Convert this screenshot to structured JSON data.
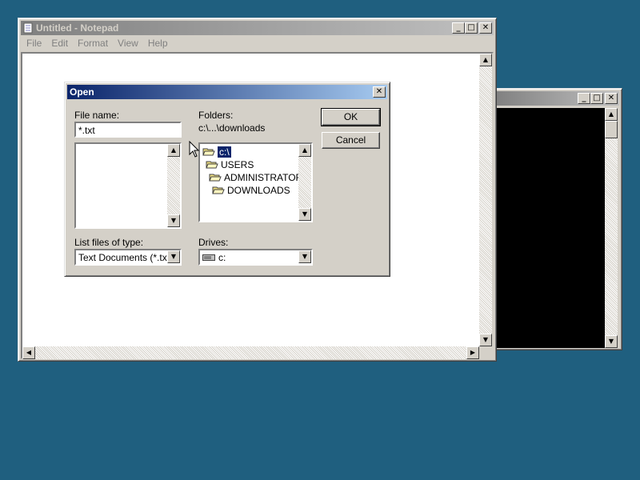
{
  "console_window": {
    "minimize_glyph": "_",
    "maximize_glyph": "□",
    "close_glyph": "✕",
    "scroll_up_glyph": "▲",
    "scroll_down_glyph": "▼"
  },
  "notepad": {
    "title": "Untitled - Notepad",
    "minimize_glyph": "_",
    "maximize_glyph": "□",
    "close_glyph": "✕",
    "menu": [
      "File",
      "Edit",
      "Format",
      "View",
      "Help"
    ],
    "scroll_up_glyph": "▲",
    "scroll_down_glyph": "▼",
    "scroll_left_glyph": "◀",
    "scroll_right_glyph": "▶"
  },
  "open_dialog": {
    "title": "Open",
    "close_glyph": "✕",
    "file_name_label": "File name:",
    "file_name_value": "*.txt",
    "folders_label": "Folders:",
    "current_folder": "c:\\...\\downloads",
    "folders": [
      {
        "name": "c:\\",
        "selected": true
      },
      {
        "name": "USERS",
        "selected": false
      },
      {
        "name": "ADMINISTRATOR",
        "selected": false
      },
      {
        "name": "DOWNLOADS",
        "selected": false
      }
    ],
    "list_type_label": "List files of type:",
    "list_type_value": "Text Documents (*.txt)",
    "drives_label": "Drives:",
    "drives_value": "c:",
    "ok_label": "OK",
    "cancel_label": "Cancel",
    "scroll_up_glyph": "▲",
    "scroll_down_glyph": "▼",
    "dropdown_glyph": "▼"
  },
  "colors": {
    "desktop": "#1f5f7f",
    "active_title": "#0a246a",
    "selection": "#0a246a"
  }
}
